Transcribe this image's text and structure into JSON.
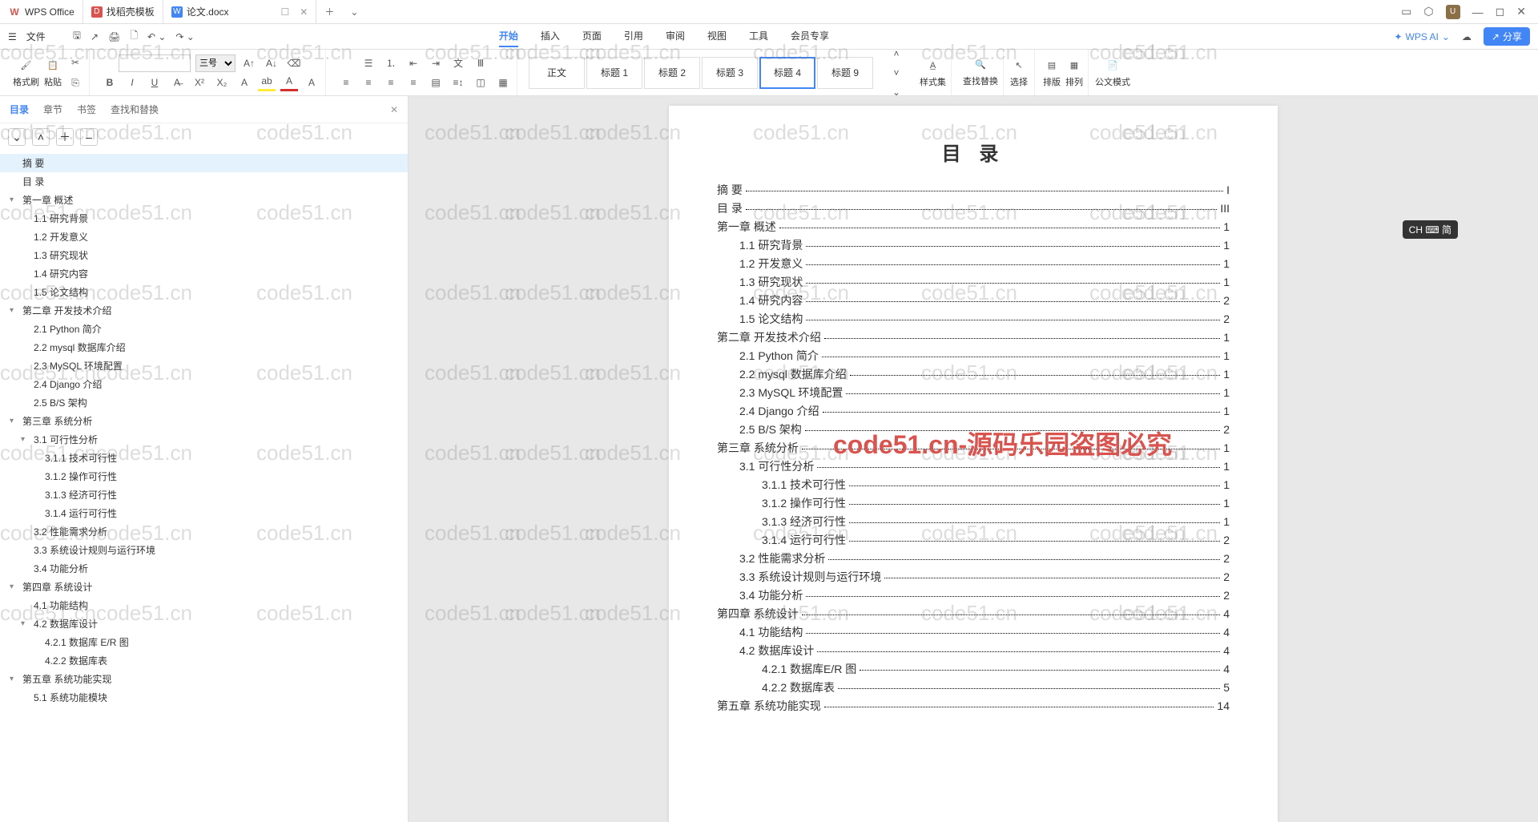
{
  "title_bar": {
    "tabs": [
      {
        "icon": "wps",
        "label": "WPS Office"
      },
      {
        "icon": "template",
        "label": "找稻壳模板"
      },
      {
        "icon": "doc",
        "label": "论文.docx",
        "active": true,
        "closable": true
      }
    ]
  },
  "menu": {
    "file": "文件",
    "items": [
      "开始",
      "插入",
      "页面",
      "引用",
      "审阅",
      "视图",
      "工具",
      "会员专享"
    ],
    "active_index": 0,
    "wps_ai": "WPS AI",
    "share": "分享"
  },
  "ribbon": {
    "format_painter": "格式刷",
    "paste": "粘贴",
    "font_size": "三号",
    "styles": [
      "正文",
      "标题 1",
      "标题 2",
      "标题 3",
      "标题 4",
      "标题 9"
    ],
    "selected_style": 4,
    "style_set": "样式集",
    "find_replace": "查找替换",
    "select": "选择",
    "layout": "排版",
    "arrange": "排列",
    "official_mode": "公文模式"
  },
  "sidebar": {
    "tabs": [
      "目录",
      "章节",
      "书签",
      "查找和替换"
    ],
    "active_tab": 0,
    "outline": [
      {
        "lvl": 0,
        "text": "摘  要",
        "selected": true
      },
      {
        "lvl": 0,
        "text": "目  录"
      },
      {
        "lvl": 0,
        "text": "第一章 概述",
        "toggle": true
      },
      {
        "lvl": 1,
        "text": "1.1 研究背景"
      },
      {
        "lvl": 1,
        "text": "1.2 开发意义"
      },
      {
        "lvl": 1,
        "text": "1.3 研究现状"
      },
      {
        "lvl": 1,
        "text": "1.4 研究内容"
      },
      {
        "lvl": 1,
        "text": "1.5 论文结构"
      },
      {
        "lvl": 0,
        "text": "第二章 开发技术介绍",
        "toggle": true
      },
      {
        "lvl": 1,
        "text": "2.1   Python 简介"
      },
      {
        "lvl": 1,
        "text": "2.2   mysql 数据库介绍"
      },
      {
        "lvl": 1,
        "text": "2.3   MySQL 环境配置"
      },
      {
        "lvl": 1,
        "text": "2.4   Django 介绍"
      },
      {
        "lvl": 1,
        "text": "2.5   B/S 架构"
      },
      {
        "lvl": 0,
        "text": "第三章 系统分析",
        "toggle": true
      },
      {
        "lvl": 1,
        "text": "3.1 可行性分析",
        "toggle": true
      },
      {
        "lvl": 2,
        "text": "3.1.1 技术可行性"
      },
      {
        "lvl": 2,
        "text": "3.1.2 操作可行性"
      },
      {
        "lvl": 2,
        "text": "3.1.3 经济可行性"
      },
      {
        "lvl": 2,
        "text": "3.1.4 运行可行性"
      },
      {
        "lvl": 1,
        "text": "3.2 性能需求分析"
      },
      {
        "lvl": 1,
        "text": "3.3 系统设计规则与运行环境"
      },
      {
        "lvl": 1,
        "text": "3.4 功能分析"
      },
      {
        "lvl": 0,
        "text": "第四章 系统设计",
        "toggle": true
      },
      {
        "lvl": 1,
        "text": "4.1 功能结构"
      },
      {
        "lvl": 1,
        "text": "4.2 数据库设计",
        "toggle": true
      },
      {
        "lvl": 2,
        "text": "4.2.1 数据库 E/R 图"
      },
      {
        "lvl": 2,
        "text": "4.2.2 数据库表"
      },
      {
        "lvl": 0,
        "text": "第五章 系统功能实现",
        "toggle": true
      },
      {
        "lvl": 1,
        "text": "5.1 系统功能模块"
      }
    ]
  },
  "document": {
    "toc_heading": "目 录",
    "entries": [
      {
        "lvl": 0,
        "label": "摘    要",
        "page": "I"
      },
      {
        "lvl": 0,
        "label": "目    录",
        "page": "III"
      },
      {
        "lvl": 0,
        "label": "第一章  概述",
        "page": "1"
      },
      {
        "lvl": 1,
        "label": "1.1  研究背景",
        "page": "1"
      },
      {
        "lvl": 1,
        "label": "1.2  开发意义",
        "page": "1"
      },
      {
        "lvl": 1,
        "label": "1.3  研究现状",
        "page": "1"
      },
      {
        "lvl": 1,
        "label": "1.4  研究内容",
        "page": "2"
      },
      {
        "lvl": 1,
        "label": "1.5  论文结构",
        "page": "2"
      },
      {
        "lvl": 0,
        "label": "第二章  开发技术介绍",
        "page": "1"
      },
      {
        "lvl": 1,
        "label": "2.1    Python 简介",
        "page": "1"
      },
      {
        "lvl": 1,
        "label": "2.2    mysql 数据库介绍",
        "page": "1"
      },
      {
        "lvl": 1,
        "label": "2.3    MySQL 环境配置",
        "page": "1"
      },
      {
        "lvl": 1,
        "label": "2.4    Django 介绍",
        "page": "1"
      },
      {
        "lvl": 1,
        "label": "2.5    B/S 架构",
        "page": "2"
      },
      {
        "lvl": 0,
        "label": "第三章  系统分析",
        "page": "1"
      },
      {
        "lvl": 1,
        "label": "3.1  可行性分析",
        "page": "1"
      },
      {
        "lvl": 2,
        "label": "3.1.1  技术可行性",
        "page": "1"
      },
      {
        "lvl": 2,
        "label": "3.1.2  操作可行性",
        "page": "1"
      },
      {
        "lvl": 2,
        "label": "3.1.3  经济可行性",
        "page": "1"
      },
      {
        "lvl": 2,
        "label": "3.1.4  运行可行性",
        "page": "2"
      },
      {
        "lvl": 1,
        "label": "3.2  性能需求分析",
        "page": "2"
      },
      {
        "lvl": 1,
        "label": "3.3  系统设计规则与运行环境",
        "page": "2"
      },
      {
        "lvl": 1,
        "label": "3.4  功能分析",
        "page": "2"
      },
      {
        "lvl": 0,
        "label": "第四章  系统设计",
        "page": "4"
      },
      {
        "lvl": 1,
        "label": "4.1  功能结构",
        "page": "4"
      },
      {
        "lvl": 1,
        "label": "4.2  数据库设计",
        "page": "4"
      },
      {
        "lvl": 2,
        "label": "4.2.1  数据库E/R 图",
        "page": "4"
      },
      {
        "lvl": 2,
        "label": "4.2.2  数据库表",
        "page": "5"
      },
      {
        "lvl": 0,
        "label": "第五章  系统功能实现",
        "page": "14"
      }
    ]
  },
  "watermark": "code51.cn",
  "watermark_red": "code51.cn-源码乐园盗图必究",
  "ime": "CH ⌨ 简"
}
